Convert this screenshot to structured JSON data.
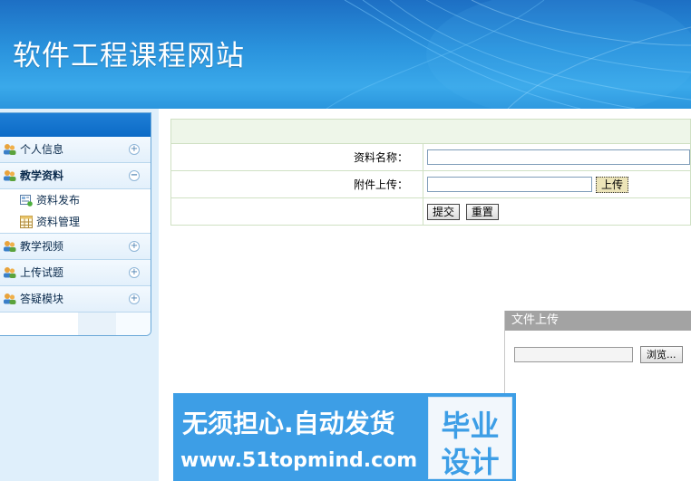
{
  "header": {
    "title": "软件工程课程网站"
  },
  "sidebar": {
    "items": [
      {
        "label": "个人信息",
        "toggle": "+"
      },
      {
        "label": "教学资料",
        "toggle": "−",
        "children": [
          {
            "label": "资料发布"
          },
          {
            "label": "资料管理"
          }
        ]
      },
      {
        "label": "教学视频",
        "toggle": "+"
      },
      {
        "label": "上传试题",
        "toggle": "+"
      },
      {
        "label": "答疑模块",
        "toggle": "+"
      }
    ]
  },
  "form": {
    "name_label": "资料名称：",
    "name_value": "",
    "attach_label": "附件上传：",
    "attach_value": "",
    "upload_button": "上传",
    "submit_button": "提交",
    "reset_button": "重置"
  },
  "upload_dialog": {
    "title": "文件上传",
    "browse_button": "浏览..."
  },
  "watermark": {
    "line1": "无须担心.自动发货",
    "line2": "www.51topmind.com",
    "seal_line1": "毕业",
    "seal_line2": "设计"
  },
  "colors": {
    "header": "#2a93dd",
    "menu_top": "#1f7fd6",
    "banner": "#3d9ee6"
  }
}
